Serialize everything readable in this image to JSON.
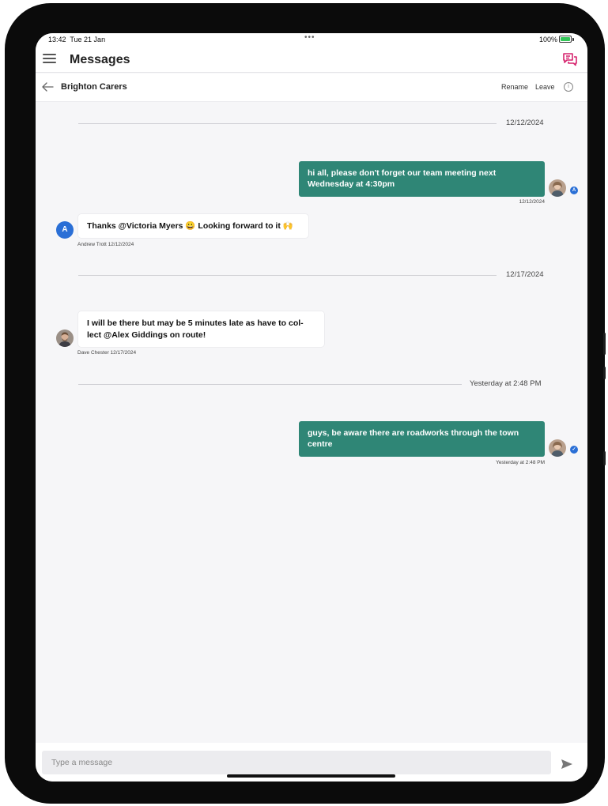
{
  "status_bar": {
    "time": "13:42",
    "date": "Tue 21 Jan",
    "dots": "•••",
    "battery": "100%"
  },
  "app_header": {
    "title": "Messages"
  },
  "conversation": {
    "title": "Brighton Carers",
    "rename_label": "Rename",
    "leave_label": "Leave"
  },
  "date_separators": [
    "12/12/2024",
    "12/17/2024",
    "Yesterday at 2:48 PM"
  ],
  "messages": [
    {
      "direction": "outgoing",
      "text": "hi all, please don't forget our team meeting next Wednesday at 4:30pm",
      "timestamp": "12/12/2024",
      "read_badge": "A"
    },
    {
      "direction": "incoming",
      "avatar_letter": "A",
      "text": "Thanks @Victoria Myers 😀 Looking forward to it 🙌",
      "meta": "Andrew Trott 12/12/2024"
    },
    {
      "direction": "incoming",
      "text": "I will be there but may be 5 minutes late as have to col-lect @Alex Giddings on route!",
      "meta": "Dave Chester 12/17/2024"
    },
    {
      "direction": "outgoing",
      "text": "guys, be aware there are roadworks through the town centre",
      "timestamp": "Yesterday at 2:48 PM",
      "read_badge": "✓"
    }
  ],
  "composer": {
    "placeholder": "Type a message"
  },
  "colors": {
    "outgoing_bubble": "#2f8676",
    "accent_blue": "#2a6fd6",
    "chat_icon": "#d6246e"
  }
}
